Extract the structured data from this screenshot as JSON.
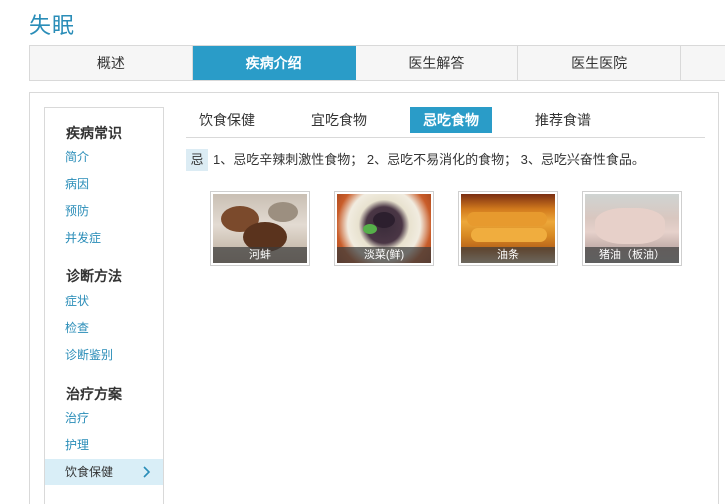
{
  "page": {
    "title": "失眠"
  },
  "main_tabs": [
    {
      "label": "概述"
    },
    {
      "label": "疾病介绍",
      "active": true
    },
    {
      "label": "医生解答"
    },
    {
      "label": "医生医院"
    }
  ],
  "sidebar": {
    "groups": [
      {
        "title": "疾病常识",
        "items": [
          "简介",
          "病因",
          "预防",
          "并发症"
        ]
      },
      {
        "title": "诊断方法",
        "items": [
          "症状",
          "检查",
          "诊断鉴别"
        ]
      },
      {
        "title": "治疗方案",
        "items": [
          "治疗",
          "护理",
          "饮食保健"
        ]
      }
    ],
    "active_item": "饮食保健",
    "active_icon": "chevron-right-icon"
  },
  "sub_tabs": [
    {
      "label": "饮食保健"
    },
    {
      "label": "宜吃食物"
    },
    {
      "label": "忌吃食物",
      "active": true
    },
    {
      "label": "推荐食谱"
    }
  ],
  "tip": {
    "badge": "忌",
    "text": "1、忌吃辛辣刺激性食物； 2、忌吃不易消化的食物； 3、忌吃兴奋性食品。"
  },
  "foods": [
    {
      "name": "河蚌"
    },
    {
      "name": "淡菜(鲜)"
    },
    {
      "name": "油条"
    },
    {
      "name": "猪油（板油）"
    }
  ],
  "colors": {
    "accent": "#2a9cc8",
    "link": "#2a8db8",
    "active_bg": "#d9eef7"
  }
}
